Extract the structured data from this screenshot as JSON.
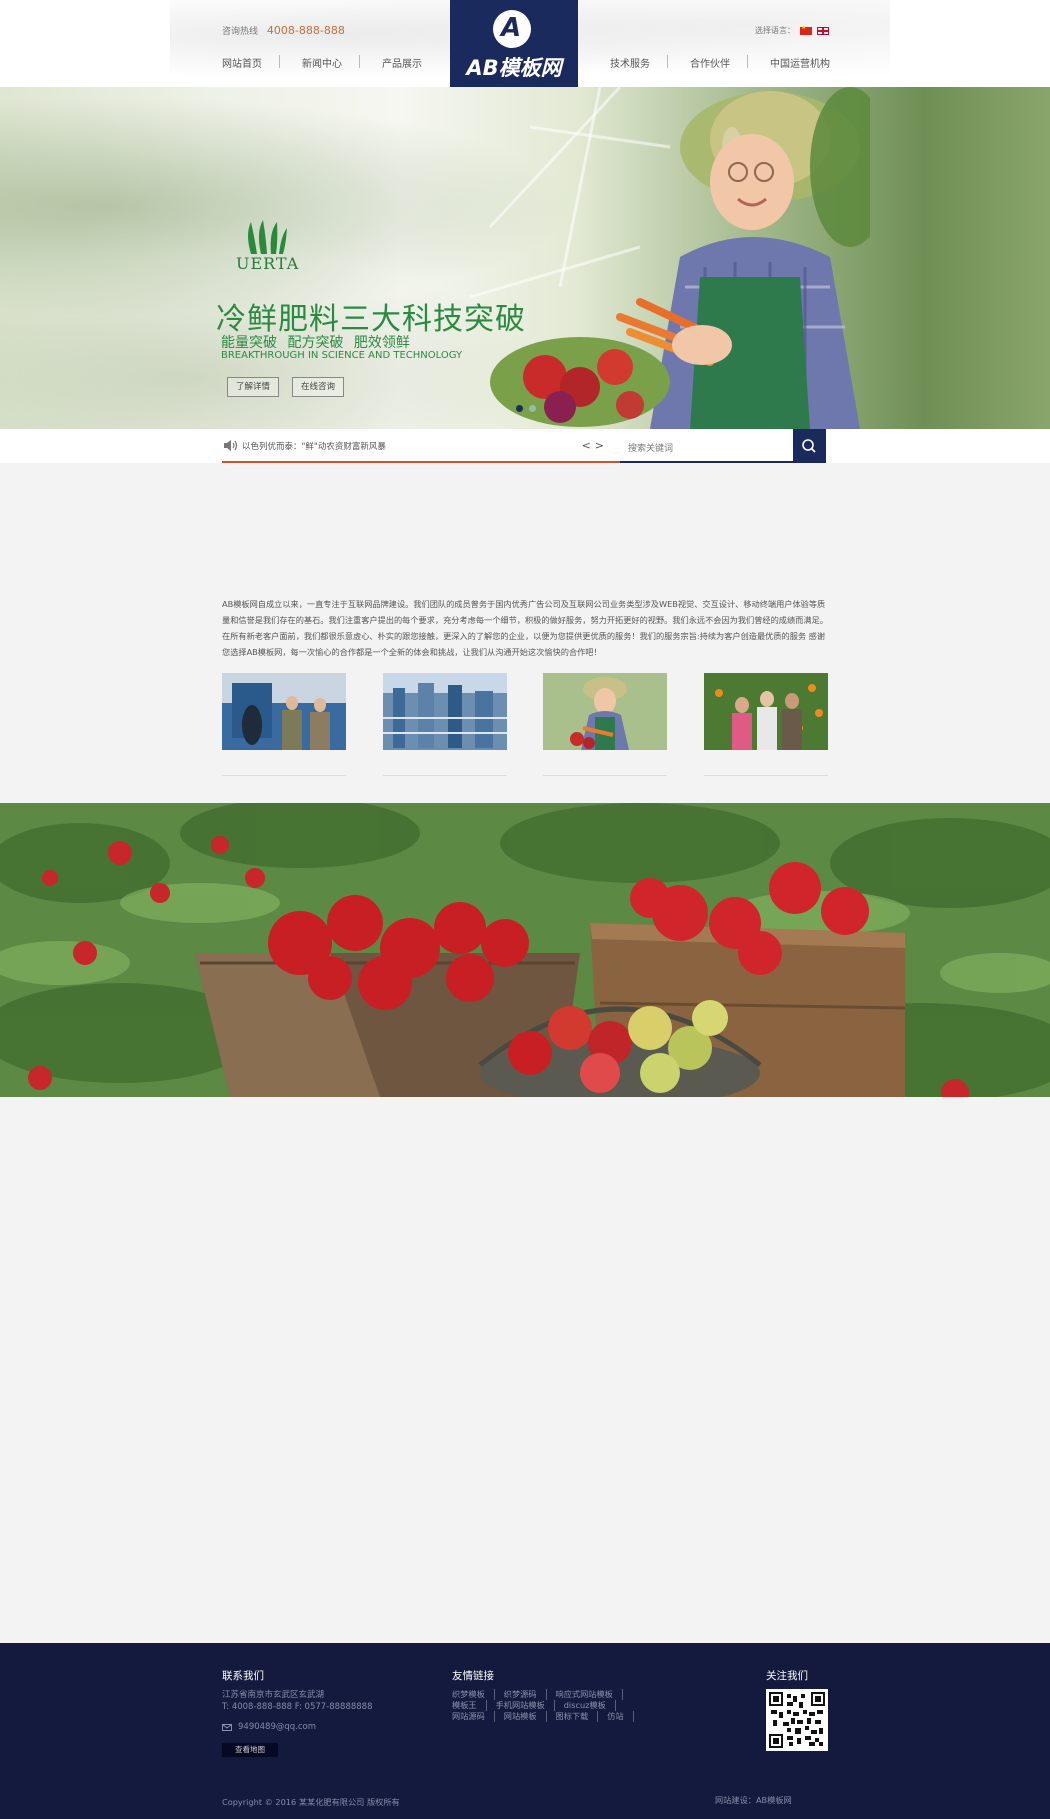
{
  "header": {
    "hotline_label": "咨询热线",
    "hotline_number": "4008-888-888",
    "lang_label": "选择语言：",
    "logo_letter": "A",
    "logo_text": "AB模板网",
    "nav_left": [
      "网站首页",
      "新闻中心",
      "产品展示"
    ],
    "nav_right": [
      "技术服务",
      "合作伙伴",
      "中国运营机构"
    ]
  },
  "banner": {
    "brand_name": "UERTA",
    "title": "冷鲜肥料三大科技突破",
    "subtitle": "能量突破  配方突破  肥效领鲜",
    "english": "BREAKTHROUGH IN SCIENCE AND TECHNOLOGY",
    "btn_detail": "了解详情",
    "btn_consult": "在线咨询",
    "slides": 2,
    "active_slide": 1
  },
  "news": {
    "ticker_text": "以色列优而泰：\"鲜\"动农资财富新风暴",
    "prev": "<",
    "next": ">"
  },
  "search": {
    "placeholder": "搜索关键词"
  },
  "about": {
    "text": "AB模板网自成立以来，一直专注于互联网品牌建设。我们团队的成员曾务于国内优秀广告公司及互联网公司业务类型涉及WEB视觉、交互设计、移动终端用户体验等质量和信誉是我们存在的基石。我们注重客户提出的每个要求，充分考虑每一个细节，积极的做好服务，努力开拓更好的视野。我们永远不会因为我们曾经的成绩而满足。在所有新老客户面前，我们都很乐意虚心、朴实的跟您接触，更深入的了解您的企业，以便为您提供更优质的服务！我们的服务宗旨:持续为客户创造最优质的服务 感谢您选择AB模板网，每一次愉心的合作都是一个全新的体会和挑战，让我们从沟通开始这次愉快的合作吧！"
  },
  "footer": {
    "contact_title": "联系我们",
    "address": "江苏省南京市玄武区玄武湖",
    "phone": "T: 4008-888-888 F: 0577-88888888",
    "email": "9490489@qq.com",
    "map_button": "查看地图",
    "links_title": "友情链接",
    "links": [
      "织梦模板",
      "织梦源码",
      "响应式网站模板",
      "模板王",
      "手机网站模板",
      "discuz模板",
      "网站源码",
      "网站模板",
      "图标下载",
      "仿站"
    ],
    "follow_title": "关注我们",
    "copyright": "Copyright © 2016 某某化肥有限公司 版权所有",
    "credit": "网站建设：AB模板网"
  },
  "colors": {
    "brand_navy": "#1b2a5c",
    "footer_bg": "#141a3d",
    "accent_orange": "#c8552f",
    "banner_green": "#2b8a42"
  }
}
